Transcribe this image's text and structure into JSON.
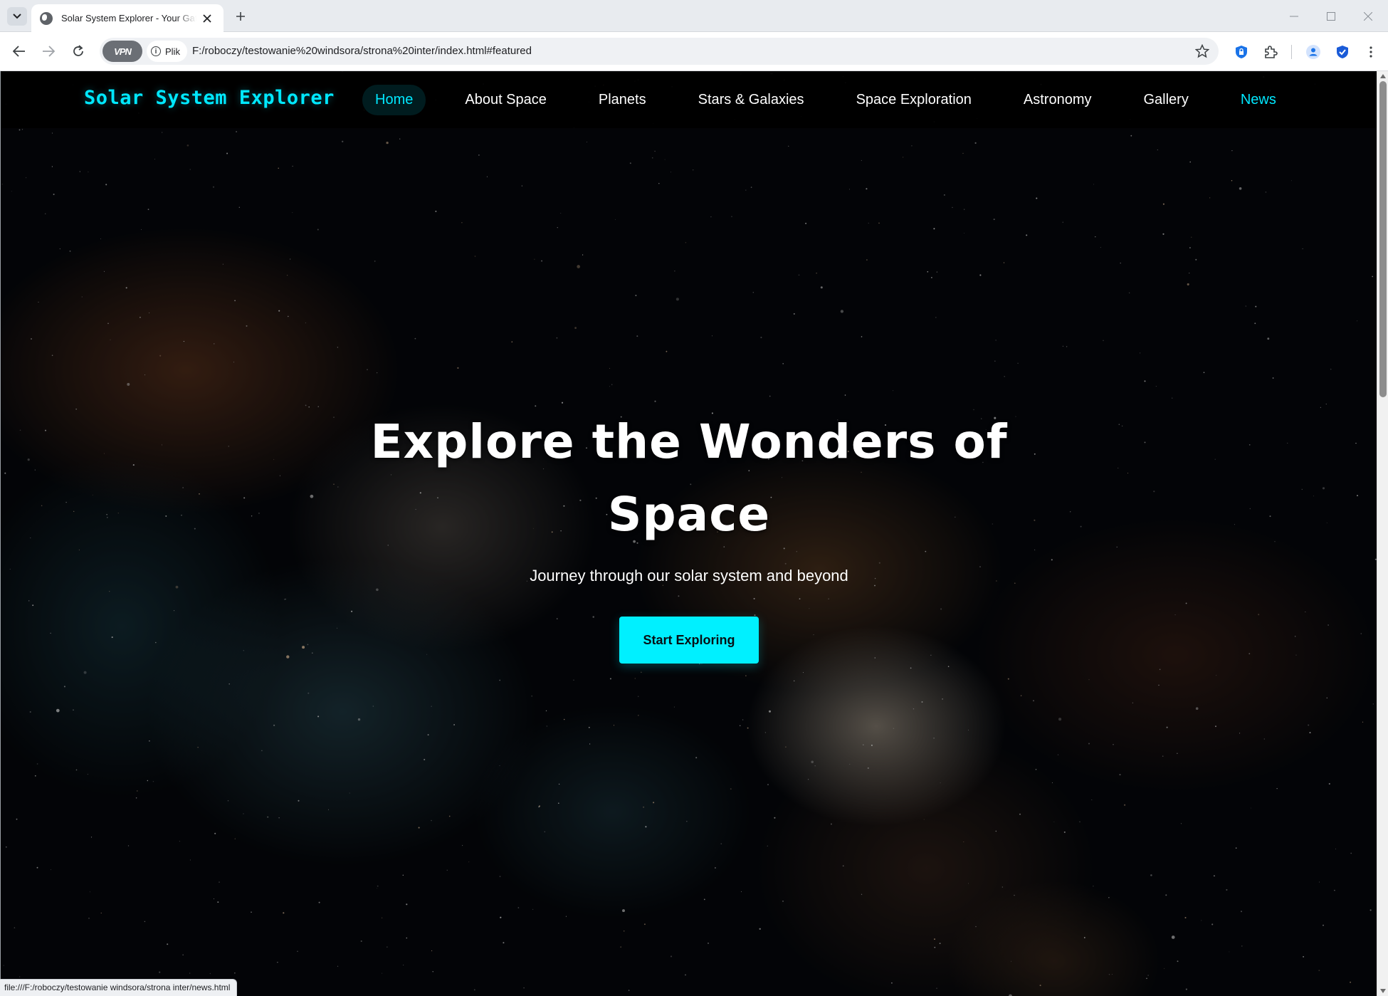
{
  "browser": {
    "tab_title": "Solar System Explorer - Your Gateway to Space",
    "url_scheme_label": "Plik",
    "url": "F:/roboczy/testowanie%20windsora/strona%20inter/index.html#featured",
    "vpn_label": "VPN",
    "status_url": "file:///F:/roboczy/testowanie windsora/strona inter/news.html"
  },
  "site": {
    "logo": "Solar System Explorer",
    "nav": [
      {
        "label": "Home",
        "state": "active"
      },
      {
        "label": "About Space",
        "state": ""
      },
      {
        "label": "Planets",
        "state": ""
      },
      {
        "label": "Stars & Galaxies",
        "state": ""
      },
      {
        "label": "Space Exploration",
        "state": ""
      },
      {
        "label": "Astronomy",
        "state": ""
      },
      {
        "label": "Gallery",
        "state": ""
      },
      {
        "label": "News",
        "state": "hovered"
      }
    ]
  },
  "hero": {
    "title_line1": "Explore the Wonders of",
    "title_line2": "Space",
    "subtitle": "Journey through our solar system and beyond",
    "cta_label": "Start Exploring"
  },
  "colors": {
    "accent": "#00e8ff",
    "cta": "#00f0ff",
    "nav_bg": "#000000"
  }
}
